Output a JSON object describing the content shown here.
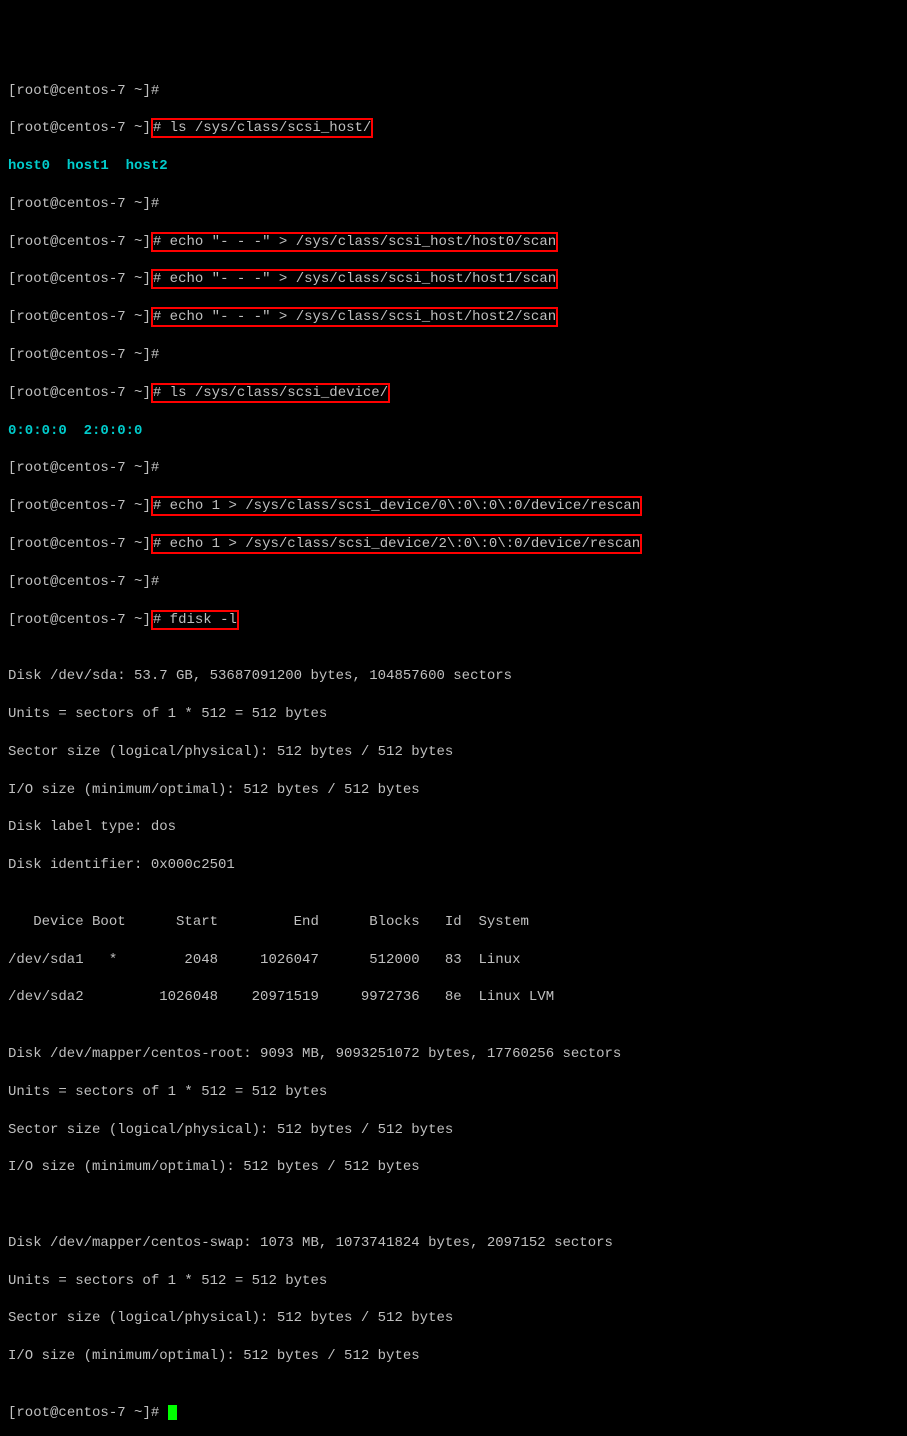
{
  "prompt": {
    "open": "[",
    "user": "root",
    "at": "@",
    "host": "centos-7",
    "path": " ~",
    "close": "]",
    "hash": "#"
  },
  "lines": {
    "l1_cmd": "",
    "l2_cmd": " ls /sys/class/scsi_host/",
    "l3_hosts": "host0  host1  host2",
    "l4_cmd": "",
    "l5_cmd": " echo \"- - -\" > /sys/class/scsi_host/host0/scan",
    "l6_cmd": " echo \"- - -\" > /sys/class/scsi_host/host1/scan",
    "l7_cmd": " echo \"- - -\" > /sys/class/scsi_host/host2/scan",
    "l8_cmd": "",
    "l9_cmd": " ls /sys/class/scsi_device/",
    "l10_devices": "0:0:0:0  2:0:0:0",
    "l11_cmd": "",
    "l12_cmd": " echo 1 > /sys/class/scsi_device/0\\:0\\:0\\:0/device/rescan",
    "l13_cmd": " echo 1 > /sys/class/scsi_device/2\\:0\\:0\\:0/device/rescan",
    "l14_cmd": "",
    "l15_cmd": " fdisk -l"
  },
  "fdisk": {
    "blank1": "",
    "disk1_l1": "Disk /dev/sda: 53.7 GB, 53687091200 bytes, 104857600 sectors",
    "disk1_l2": "Units = sectors of 1 * 512 = 512 bytes",
    "disk1_l3": "Sector size (logical/physical): 512 bytes / 512 bytes",
    "disk1_l4": "I/O size (minimum/optimal): 512 bytes / 512 bytes",
    "disk1_l5": "Disk label type: dos",
    "disk1_l6": "Disk identifier: 0x000c2501",
    "blank2": "",
    "part_hdr": "   Device Boot      Start         End      Blocks   Id  System",
    "part1": "/dev/sda1   *        2048     1026047      512000   83  Linux",
    "part2": "/dev/sda2         1026048    20971519     9972736   8e  Linux LVM",
    "blank3": "",
    "disk2_l1": "Disk /dev/mapper/centos-root: 9093 MB, 9093251072 bytes, 17760256 sectors",
    "disk2_l2": "Units = sectors of 1 * 512 = 512 bytes",
    "disk2_l3": "Sector size (logical/physical): 512 bytes / 512 bytes",
    "disk2_l4": "I/O size (minimum/optimal): 512 bytes / 512 bytes",
    "blank4": "",
    "blank5": "",
    "disk3_l1": "Disk /dev/mapper/centos-swap: 1073 MB, 1073741824 bytes, 2097152 sectors",
    "disk3_l2": "Units = sectors of 1 * 512 = 512 bytes",
    "disk3_l3": "Sector size (logical/physical): 512 bytes / 512 bytes",
    "disk3_l4": "I/O size (minimum/optimal): 512 bytes / 512 bytes",
    "blank6": "",
    "final_cmd": " "
  }
}
